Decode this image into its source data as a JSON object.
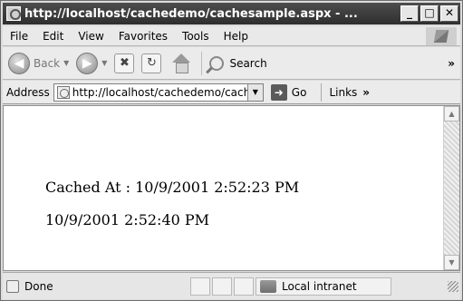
{
  "window": {
    "title": "http://localhost/cachedemo/cachesample.aspx - ...",
    "min_label": "_",
    "max_label": "□",
    "close_label": "✕"
  },
  "menu": {
    "items": [
      "File",
      "Edit",
      "View",
      "Favorites",
      "Tools",
      "Help"
    ]
  },
  "toolbar": {
    "back_label": "Back",
    "search_label": "Search",
    "more_label": "»"
  },
  "address": {
    "label": "Address",
    "url": "http://localhost/cachedemo/cachesample.aspx",
    "go_label": "Go",
    "links_label": "Links",
    "links_more": "»"
  },
  "content": {
    "cached_at_line": "Cached At : 10/9/2001 2:52:23 PM",
    "current_time_line": "10/9/2001 2:52:40 PM"
  },
  "status": {
    "done_label": "Done",
    "zone_label": "Local intranet"
  }
}
